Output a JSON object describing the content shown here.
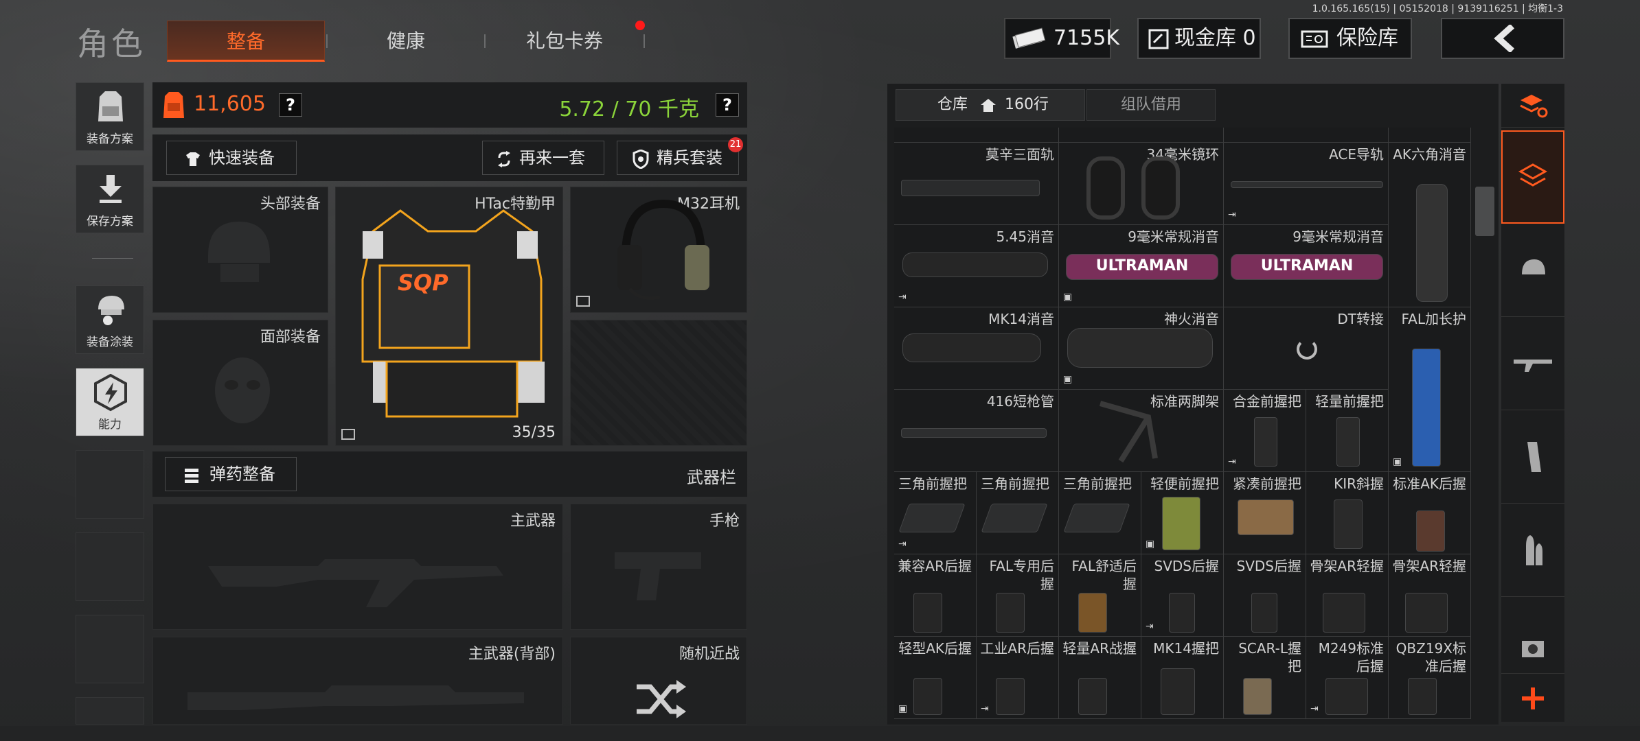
{
  "version": "1.0.165.165(15) | 05152018 | 9139116251 | 均衡1-3",
  "title": "角色",
  "tabs": [
    {
      "label": "整备",
      "active": true
    },
    {
      "label": "健康",
      "active": false
    },
    {
      "label": "礼包卡券",
      "active": false,
      "badge": true
    }
  ],
  "header": {
    "money": "7155K",
    "cash_label": "现金库 0",
    "insurance_label": "保险库",
    "back_icon": "chevron-left-icon"
  },
  "sidebar": [
    {
      "label": "装备方案",
      "icon": "vest-icon"
    },
    {
      "label": "保存方案",
      "icon": "download-icon"
    },
    {
      "label": "装备涂装",
      "icon": "helmet-paint-icon"
    },
    {
      "label": "能力",
      "icon": "lightning-icon",
      "active": true
    }
  ],
  "loadout": {
    "armor_value": "11,605",
    "weight": "5.72 / 70 千克",
    "quick_equip": "快速装备",
    "redo": "再来一套",
    "elite": "精兵套装",
    "elite_badge": "21",
    "head_slot": "头部装备",
    "face_slot": "面部装备",
    "armor_name": "HTac特勤甲",
    "armor_durability": "35/35",
    "armor_logo": "SQP",
    "earpiece_name": "M32耳机",
    "ammo_button": "弹药整备",
    "weapon_bar": "武器栏",
    "primary": "主武器",
    "pistol": "手枪",
    "primary_back": "主武器(背部)",
    "melee": "随机近战"
  },
  "warehouse": {
    "tab_label": "仓库",
    "rows_label": "160行",
    "team_tab": "组队借用",
    "items": [
      {
        "name": "莫辛三面轨"
      },
      {
        "name": "34毫米镜环"
      },
      {
        "name": "ACE导轨"
      },
      {
        "name": "AK六角消音"
      },
      {
        "name": "5.45消音"
      },
      {
        "name": "9毫米常规消音",
        "brand": "ULTRAMAN"
      },
      {
        "name": "9毫米常规消音",
        "brand": "ULTRAMAN"
      },
      {
        "name": "MK14消音"
      },
      {
        "name": "神火消音"
      },
      {
        "name": "DT转接"
      },
      {
        "name": "FAL加长护"
      },
      {
        "name": "416短枪管"
      },
      {
        "name": "标准两脚架"
      },
      {
        "name": "合金前握把"
      },
      {
        "name": "轻量前握把"
      },
      {
        "name": "三角前握把"
      },
      {
        "name": "三角前握把"
      },
      {
        "name": "三角前握把"
      },
      {
        "name": "轻便前握把"
      },
      {
        "name": "紧凑前握把"
      },
      {
        "name": "KIR斜握"
      },
      {
        "name": "标准AK后握"
      },
      {
        "name": "兼容AR后握"
      },
      {
        "name": "FAL专用后握"
      },
      {
        "name": "FAL舒适后握"
      },
      {
        "name": "SVDS后握"
      },
      {
        "name": "SVDS后握"
      },
      {
        "name": "骨架AR轻握"
      },
      {
        "name": "骨架AR轻握"
      },
      {
        "name": "轻型AK后握"
      },
      {
        "name": "工业AR后握"
      },
      {
        "name": "轻量AR战握"
      },
      {
        "name": "MK14握把"
      },
      {
        "name": "SCAR-L握把"
      },
      {
        "name": "M249标准后握"
      },
      {
        "name": "QBZ19X标准后握"
      }
    ]
  },
  "colors": {
    "accent": "#ff5a1f",
    "weight_green": "#8bd43a",
    "armor_orange": "#ff6a2a"
  }
}
